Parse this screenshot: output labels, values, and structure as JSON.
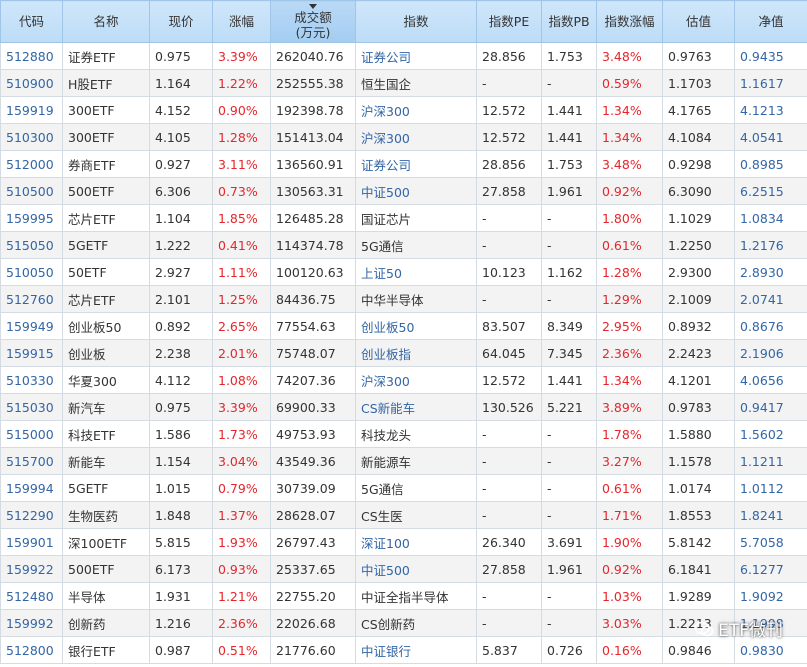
{
  "header": {
    "code": "代码",
    "name": "名称",
    "price": "现价",
    "change": "涨幅",
    "volume_line1": "成交额",
    "volume_line2": "(万元)",
    "index": "指数",
    "index_pe": "指数PE",
    "index_pb": "指数PB",
    "index_change": "指数涨幅",
    "valuation": "估值",
    "nav": "净值"
  },
  "rows": [
    {
      "code": "512880",
      "name": "证券ETF",
      "price": "0.975",
      "change": "3.39%",
      "volume": "262040.76",
      "index": "证券公司",
      "index_link": true,
      "pe": "28.856",
      "pb": "1.753",
      "index_change": "3.48%",
      "valuation": "0.9763",
      "nav": "0.9435"
    },
    {
      "code": "510900",
      "name": "H股ETF",
      "price": "1.164",
      "change": "1.22%",
      "volume": "252555.38",
      "index": "恒生国企",
      "index_link": false,
      "pe": "-",
      "pb": "-",
      "index_change": "0.59%",
      "valuation": "1.1703",
      "nav": "1.1617"
    },
    {
      "code": "159919",
      "name": "300ETF",
      "price": "4.152",
      "change": "0.90%",
      "volume": "192398.78",
      "index": "沪深300",
      "index_link": true,
      "pe": "12.572",
      "pb": "1.441",
      "index_change": "1.34%",
      "valuation": "4.1765",
      "nav": "4.1213"
    },
    {
      "code": "510300",
      "name": "300ETF",
      "price": "4.105",
      "change": "1.28%",
      "volume": "151413.04",
      "index": "沪深300",
      "index_link": true,
      "pe": "12.572",
      "pb": "1.441",
      "index_change": "1.34%",
      "valuation": "4.1084",
      "nav": "4.0541"
    },
    {
      "code": "512000",
      "name": "券商ETF",
      "price": "0.927",
      "change": "3.11%",
      "volume": "136560.91",
      "index": "证券公司",
      "index_link": true,
      "pe": "28.856",
      "pb": "1.753",
      "index_change": "3.48%",
      "valuation": "0.9298",
      "nav": "0.8985"
    },
    {
      "code": "510500",
      "name": "500ETF",
      "price": "6.306",
      "change": "0.73%",
      "volume": "130563.31",
      "index": "中证500",
      "index_link": true,
      "pe": "27.858",
      "pb": "1.961",
      "index_change": "0.92%",
      "valuation": "6.3090",
      "nav": "6.2515"
    },
    {
      "code": "159995",
      "name": "芯片ETF",
      "price": "1.104",
      "change": "1.85%",
      "volume": "126485.28",
      "index": "国证芯片",
      "index_link": false,
      "pe": "-",
      "pb": "-",
      "index_change": "1.80%",
      "valuation": "1.1029",
      "nav": "1.0834"
    },
    {
      "code": "515050",
      "name": "5GETF",
      "price": "1.222",
      "change": "0.41%",
      "volume": "114374.78",
      "index": "5G通信",
      "index_link": false,
      "pe": "-",
      "pb": "-",
      "index_change": "0.61%",
      "valuation": "1.2250",
      "nav": "1.2176"
    },
    {
      "code": "510050",
      "name": "50ETF",
      "price": "2.927",
      "change": "1.11%",
      "volume": "100120.63",
      "index": "上证50",
      "index_link": true,
      "pe": "10.123",
      "pb": "1.162",
      "index_change": "1.28%",
      "valuation": "2.9300",
      "nav": "2.8930"
    },
    {
      "code": "512760",
      "name": "芯片ETF",
      "price": "2.101",
      "change": "1.25%",
      "volume": "84436.75",
      "index": "中华半导体",
      "index_link": false,
      "pe": "-",
      "pb": "-",
      "index_change": "1.29%",
      "valuation": "2.1009",
      "nav": "2.0741"
    },
    {
      "code": "159949",
      "name": "创业板50",
      "price": "0.892",
      "change": "2.65%",
      "volume": "77554.63",
      "index": "创业板50",
      "index_link": true,
      "pe": "83.507",
      "pb": "8.349",
      "index_change": "2.95%",
      "valuation": "0.8932",
      "nav": "0.8676"
    },
    {
      "code": "159915",
      "name": "创业板",
      "price": "2.238",
      "change": "2.01%",
      "volume": "75748.07",
      "index": "创业板指",
      "index_link": true,
      "pe": "64.045",
      "pb": "7.345",
      "index_change": "2.36%",
      "valuation": "2.2423",
      "nav": "2.1906"
    },
    {
      "code": "510330",
      "name": "华夏300",
      "price": "4.112",
      "change": "1.08%",
      "volume": "74207.36",
      "index": "沪深300",
      "index_link": true,
      "pe": "12.572",
      "pb": "1.441",
      "index_change": "1.34%",
      "valuation": "4.1201",
      "nav": "4.0656"
    },
    {
      "code": "515030",
      "name": "新汽车",
      "price": "0.975",
      "change": "3.39%",
      "volume": "69900.33",
      "index": "CS新能车",
      "index_link": true,
      "pe": "130.526",
      "pb": "5.221",
      "index_change": "3.89%",
      "valuation": "0.9783",
      "nav": "0.9417"
    },
    {
      "code": "515000",
      "name": "科技ETF",
      "price": "1.586",
      "change": "1.73%",
      "volume": "49753.93",
      "index": "科技龙头",
      "index_link": false,
      "pe": "-",
      "pb": "-",
      "index_change": "1.78%",
      "valuation": "1.5880",
      "nav": "1.5602"
    },
    {
      "code": "515700",
      "name": "新能车",
      "price": "1.154",
      "change": "3.04%",
      "volume": "43549.36",
      "index": "新能源车",
      "index_link": false,
      "pe": "-",
      "pb": "-",
      "index_change": "3.27%",
      "valuation": "1.1578",
      "nav": "1.1211"
    },
    {
      "code": "159994",
      "name": "5GETF",
      "price": "1.015",
      "change": "0.79%",
      "volume": "30739.09",
      "index": "5G通信",
      "index_link": false,
      "pe": "-",
      "pb": "-",
      "index_change": "0.61%",
      "valuation": "1.0174",
      "nav": "1.0112"
    },
    {
      "code": "512290",
      "name": "生物医药",
      "price": "1.848",
      "change": "1.37%",
      "volume": "28628.07",
      "index": "CS生医",
      "index_link": false,
      "pe": "-",
      "pb": "-",
      "index_change": "1.71%",
      "valuation": "1.8553",
      "nav": "1.8241"
    },
    {
      "code": "159901",
      "name": "深100ETF",
      "price": "5.815",
      "change": "1.93%",
      "volume": "26797.43",
      "index": "深证100",
      "index_link": true,
      "pe": "26.340",
      "pb": "3.691",
      "index_change": "1.90%",
      "valuation": "5.8142",
      "nav": "5.7058"
    },
    {
      "code": "159922",
      "name": "500ETF",
      "price": "6.173",
      "change": "0.93%",
      "volume": "25337.65",
      "index": "中证500",
      "index_link": true,
      "pe": "27.858",
      "pb": "1.961",
      "index_change": "0.92%",
      "valuation": "6.1841",
      "nav": "6.1277"
    },
    {
      "code": "512480",
      "name": "半导体",
      "price": "1.931",
      "change": "1.21%",
      "volume": "22755.20",
      "index": "中证全指半导体",
      "index_link": false,
      "pe": "-",
      "pb": "-",
      "index_change": "1.03%",
      "valuation": "1.9289",
      "nav": "1.9092"
    },
    {
      "code": "159992",
      "name": "创新药",
      "price": "1.216",
      "change": "2.36%",
      "volume": "22026.68",
      "index": "CS创新药",
      "index_link": false,
      "pe": "-",
      "pb": "-",
      "index_change": "3.03%",
      "valuation": "1.2213",
      "nav": "1.1998"
    },
    {
      "code": "512800",
      "name": "银行ETF",
      "price": "0.987",
      "change": "0.51%",
      "volume": "21776.60",
      "index": "中证银行",
      "index_link": true,
      "pe": "5.837",
      "pb": "0.726",
      "index_change": "0.16%",
      "valuation": "0.9846",
      "nav": "0.9830"
    }
  ],
  "watermark": {
    "text": "ETF微刊"
  },
  "colors": {
    "up": "#e5262c",
    "link": "#3366a6",
    "header_bg": "#c4e0f8"
  },
  "sort": {
    "column": "volume",
    "direction": "desc",
    "icon": "sort-desc-icon"
  }
}
